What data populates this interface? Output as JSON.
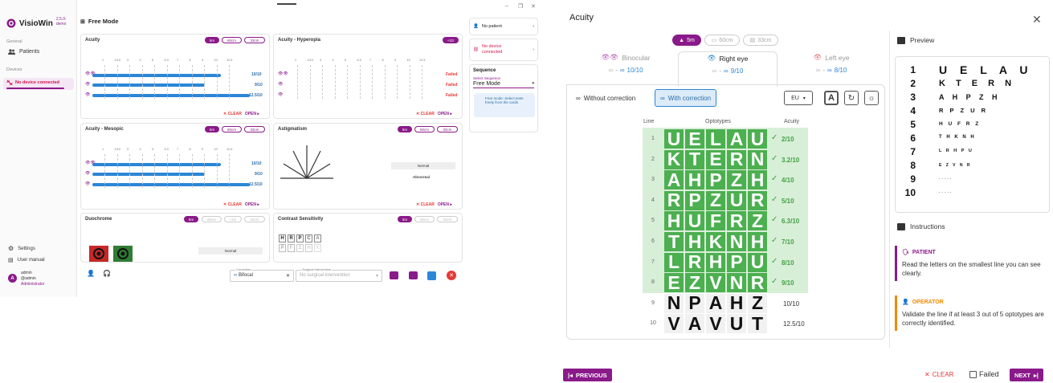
{
  "app": {
    "name": "VisioWin",
    "version": "2.5.0-demo",
    "mode_title": "Free Mode",
    "window_controls": [
      "–",
      "❐",
      "✕"
    ],
    "sidebar": {
      "general_label": "General",
      "patients": "Patients",
      "devices_label": "Devices",
      "no_device": "No device connected",
      "settings": "Settings",
      "user_manual": "User manual",
      "user_name": "admin",
      "user_login": "@admin",
      "user_role": "Administrator",
      "avatar_letter": "A"
    },
    "right_panel": {
      "no_patient": "No patient",
      "no_device_line1": "No device",
      "no_device_line2": "connected",
      "sequence_title": "Sequence",
      "select_label": "Select Sequence",
      "select_value": "Free Mode",
      "info": "Free mode: Select tests freely from the cards"
    },
    "cards": {
      "acuity": "Acuity",
      "hyperopia": "Acuity - Hyperopia",
      "mesopic": "Acuity - Mesopic",
      "astigmatism": "Astigmatism",
      "duochrome": "Duochrome",
      "contrast": "Contrast Sensitivity",
      "pill_5m": "5m",
      "pill_60": "60cm",
      "pill_33": "33cm",
      "pill_p1d": "+1D",
      "clear": "CLEAR",
      "open": "OPEN",
      "acuity_vals": [
        "10/10",
        "9/10",
        "12.5/10"
      ],
      "failed": "Failed",
      "normal": "Normal",
      "abnormal": "Abnormal",
      "contrast_letters": [
        "H",
        "R",
        "P",
        "C",
        "A",
        "P",
        "F",
        "Z",
        "H",
        "K"
      ],
      "scale_ticks": [
        "1",
        "2/10",
        "3",
        "4",
        "5",
        "6.3",
        "7",
        "8",
        "9",
        "10",
        "12.5"
      ]
    },
    "bottom": {
      "correction_label": "Correction",
      "correction_value": "Bifocal",
      "surgical_label": "Surgical intervention",
      "surgical_value": "No surgical intervention"
    }
  },
  "dialog": {
    "title": "Acuity",
    "distances": [
      {
        "label": "5m",
        "active": true
      },
      {
        "label": "60cm",
        "active": false
      },
      {
        "label": "33cm",
        "active": false
      }
    ],
    "eyes": [
      {
        "name": "Binocular",
        "score": "10/10",
        "selected": false
      },
      {
        "name": "Right eye",
        "score": "9/10",
        "selected": true
      },
      {
        "name": "Left eye",
        "score": "8/10",
        "selected": false
      }
    ],
    "score_dash": "-",
    "without_correction": "Without correction",
    "with_correction": "With correction",
    "chart_standard": "EU",
    "font_btn": "A",
    "headers": {
      "line": "Line",
      "optotypes": "Optotypes",
      "acuity": "Acuity"
    },
    "rows": [
      {
        "line": "1",
        "letters": "UELAU",
        "acuity": "2/10",
        "validated": true
      },
      {
        "line": "2",
        "letters": "KTERN",
        "acuity": "3.2/10",
        "validated": true
      },
      {
        "line": "3",
        "letters": "AHPZH",
        "acuity": "4/10",
        "validated": true
      },
      {
        "line": "4",
        "letters": "RPZUR",
        "acuity": "5/10",
        "validated": true
      },
      {
        "line": "5",
        "letters": "HUFRZ",
        "acuity": "6.3/10",
        "validated": true
      },
      {
        "line": "6",
        "letters": "THKNH",
        "acuity": "7/10",
        "validated": true
      },
      {
        "line": "7",
        "letters": "LRHPU",
        "acuity": "8/10",
        "validated": true
      },
      {
        "line": "8",
        "letters": "EZVNR",
        "acuity": "9/10",
        "validated": true
      },
      {
        "line": "9",
        "letters": "NPAHZ",
        "acuity": "10/10",
        "validated": false
      },
      {
        "line": "10",
        "letters": "VAVUT",
        "acuity": "12.5/10",
        "validated": false
      }
    ],
    "preview": {
      "title": "Preview",
      "rows": [
        {
          "num": "1",
          "text": "U E L A U"
        },
        {
          "num": "2",
          "text": "K T E R N"
        },
        {
          "num": "3",
          "text": "A H P Z H"
        },
        {
          "num": "4",
          "text": "R P Z U R"
        },
        {
          "num": "5",
          "text": "H U F R Z"
        },
        {
          "num": "6",
          "text": "T H K N H"
        },
        {
          "num": "7",
          "text": "L R H P U"
        },
        {
          "num": "8",
          "text": "E Z V N R"
        },
        {
          "num": "9",
          "text": "·····"
        },
        {
          "num": "10",
          "text": "·····"
        }
      ]
    },
    "instructions": {
      "title": "Instructions",
      "patient_label": "PATIENT",
      "patient_text": "Read the letters on the smallest line you can see clearly.",
      "operator_label": "OPERATOR",
      "operator_text": "Validate the line if at least 3 out of 5 optotypes are correctly identified."
    },
    "footer": {
      "previous": "PREVIOUS",
      "clear": "CLEAR",
      "failed": "Failed",
      "next": "NEXT"
    },
    "colors": {
      "brand": "#8a1a8a",
      "valid": "#4caf50",
      "blue": "#2b86d6",
      "operator": "#f08a00",
      "danger": "#e53935"
    }
  }
}
